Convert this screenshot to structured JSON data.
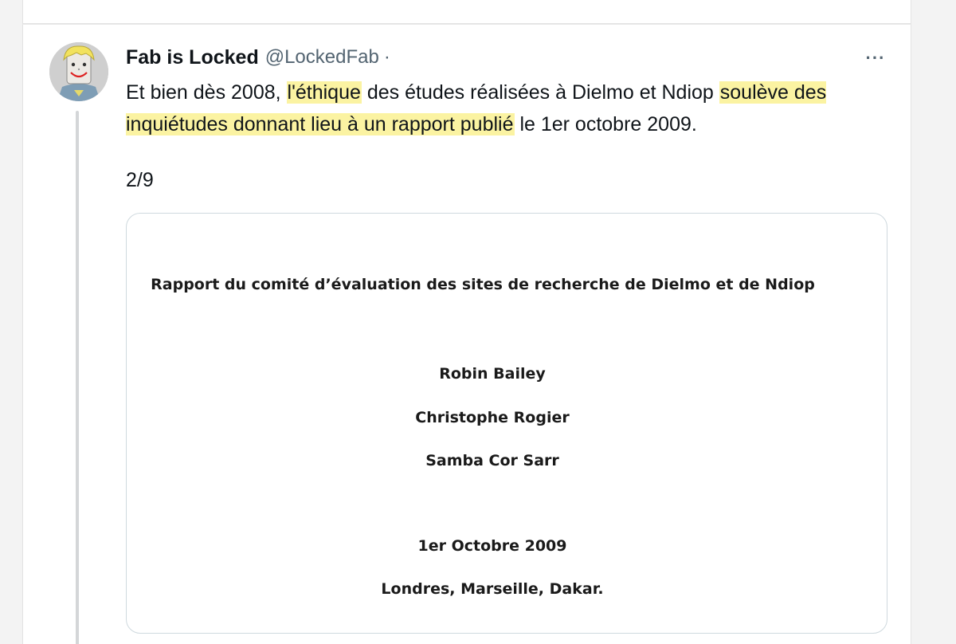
{
  "tweet": {
    "author": {
      "display_name": "Fab is Locked",
      "handle": "@LockedFab",
      "separator": "·"
    },
    "more_label": "···",
    "text_segments": [
      {
        "text": "Et bien dès 2008, ",
        "highlight": false
      },
      {
        "text": "l'éthique",
        "highlight": true
      },
      {
        "text": " des études réalisées à Dielmo et Ndiop ",
        "highlight": false
      },
      {
        "text": "soulève des inquiétudes donnant lieu à un rapport publié",
        "highlight": true
      },
      {
        "text": " le 1er octobre 2009.",
        "highlight": false
      }
    ],
    "thread_counter": "2/9",
    "highlight_color": "#fbf3a2",
    "media": {
      "title": "Rapport du comité d’évaluation des sites de recherche de Dielmo et de Ndiop",
      "authors": [
        "Robin Bailey",
        "Christophe Rogier",
        "Samba Cor Sarr"
      ],
      "date": "1er Octobre 2009",
      "places": "Londres, Marseille, Dakar."
    }
  }
}
